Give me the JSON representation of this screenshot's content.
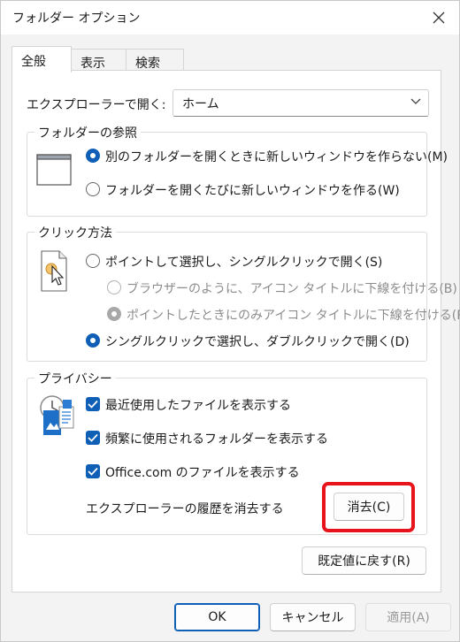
{
  "window": {
    "title": "フォルダー オプション"
  },
  "tabs": [
    {
      "label": "全般",
      "active": true
    },
    {
      "label": "表示",
      "active": false
    },
    {
      "label": "検索",
      "active": false
    }
  ],
  "open_explorer": {
    "label": "エクスプローラーで開く:",
    "selected": "ホーム"
  },
  "browse_folders": {
    "legend": "フォルダーの参照",
    "options": [
      {
        "label": "別のフォルダーを開くときに新しいウィンドウを作らない(M)",
        "selected": true
      },
      {
        "label": "フォルダーを開くたびに新しいウィンドウを作る(W)",
        "selected": false
      }
    ]
  },
  "click_items": {
    "legend": "クリック方法",
    "options": [
      {
        "label": "ポイントして選択し、シングルクリックで開く(S)",
        "selected": false
      },
      {
        "label": "ブラウザーのように、アイコン タイトルに下線を付ける(B)",
        "selected": false,
        "disabled": true
      },
      {
        "label": "ポイントしたときにのみアイコン タイトルに下線を付ける(P)",
        "selected": true,
        "disabled": true
      },
      {
        "label": "シングルクリックで選択し、ダブルクリックで開く(D)",
        "selected": true
      }
    ]
  },
  "privacy": {
    "legend": "プライバシー",
    "checks": [
      {
        "label": "最近使用したファイルを表示する",
        "checked": true
      },
      {
        "label": "頻繁に使用されるフォルダーを表示する",
        "checked": true
      },
      {
        "label": "Office.com のファイルを表示する",
        "checked": true
      }
    ],
    "clear_label": "エクスプローラーの履歴を消去する",
    "clear_button": "消去(C)"
  },
  "restore_defaults": "既定値に戻す(R)",
  "footer": {
    "ok": "OK",
    "cancel": "キャンセル",
    "apply": "適用(A)"
  },
  "colors": {
    "accent": "#0f5fb7",
    "highlight": "#e8141b"
  }
}
